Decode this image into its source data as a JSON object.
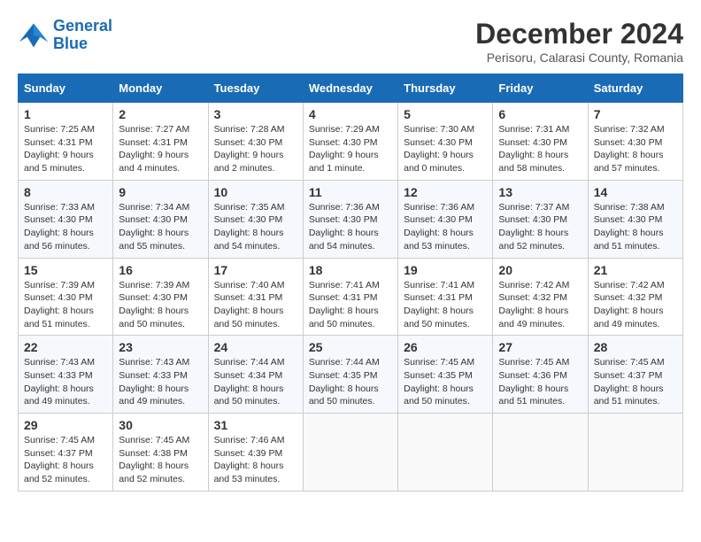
{
  "logo": {
    "line1": "General",
    "line2": "Blue"
  },
  "title": "December 2024",
  "subtitle": "Perisoru, Calarasi County, Romania",
  "days_of_week": [
    "Sunday",
    "Monday",
    "Tuesday",
    "Wednesday",
    "Thursday",
    "Friday",
    "Saturday"
  ],
  "weeks": [
    [
      {
        "day": "1",
        "info": "Sunrise: 7:25 AM\nSunset: 4:31 PM\nDaylight: 9 hours and 5 minutes."
      },
      {
        "day": "2",
        "info": "Sunrise: 7:27 AM\nSunset: 4:31 PM\nDaylight: 9 hours and 4 minutes."
      },
      {
        "day": "3",
        "info": "Sunrise: 7:28 AM\nSunset: 4:30 PM\nDaylight: 9 hours and 2 minutes."
      },
      {
        "day": "4",
        "info": "Sunrise: 7:29 AM\nSunset: 4:30 PM\nDaylight: 9 hours and 1 minute."
      },
      {
        "day": "5",
        "info": "Sunrise: 7:30 AM\nSunset: 4:30 PM\nDaylight: 9 hours and 0 minutes."
      },
      {
        "day": "6",
        "info": "Sunrise: 7:31 AM\nSunset: 4:30 PM\nDaylight: 8 hours and 58 minutes."
      },
      {
        "day": "7",
        "info": "Sunrise: 7:32 AM\nSunset: 4:30 PM\nDaylight: 8 hours and 57 minutes."
      }
    ],
    [
      {
        "day": "8",
        "info": "Sunrise: 7:33 AM\nSunset: 4:30 PM\nDaylight: 8 hours and 56 minutes."
      },
      {
        "day": "9",
        "info": "Sunrise: 7:34 AM\nSunset: 4:30 PM\nDaylight: 8 hours and 55 minutes."
      },
      {
        "day": "10",
        "info": "Sunrise: 7:35 AM\nSunset: 4:30 PM\nDaylight: 8 hours and 54 minutes."
      },
      {
        "day": "11",
        "info": "Sunrise: 7:36 AM\nSunset: 4:30 PM\nDaylight: 8 hours and 54 minutes."
      },
      {
        "day": "12",
        "info": "Sunrise: 7:36 AM\nSunset: 4:30 PM\nDaylight: 8 hours and 53 minutes."
      },
      {
        "day": "13",
        "info": "Sunrise: 7:37 AM\nSunset: 4:30 PM\nDaylight: 8 hours and 52 minutes."
      },
      {
        "day": "14",
        "info": "Sunrise: 7:38 AM\nSunset: 4:30 PM\nDaylight: 8 hours and 51 minutes."
      }
    ],
    [
      {
        "day": "15",
        "info": "Sunrise: 7:39 AM\nSunset: 4:30 PM\nDaylight: 8 hours and 51 minutes."
      },
      {
        "day": "16",
        "info": "Sunrise: 7:39 AM\nSunset: 4:30 PM\nDaylight: 8 hours and 50 minutes."
      },
      {
        "day": "17",
        "info": "Sunrise: 7:40 AM\nSunset: 4:31 PM\nDaylight: 8 hours and 50 minutes."
      },
      {
        "day": "18",
        "info": "Sunrise: 7:41 AM\nSunset: 4:31 PM\nDaylight: 8 hours and 50 minutes."
      },
      {
        "day": "19",
        "info": "Sunrise: 7:41 AM\nSunset: 4:31 PM\nDaylight: 8 hours and 50 minutes."
      },
      {
        "day": "20",
        "info": "Sunrise: 7:42 AM\nSunset: 4:32 PM\nDaylight: 8 hours and 49 minutes."
      },
      {
        "day": "21",
        "info": "Sunrise: 7:42 AM\nSunset: 4:32 PM\nDaylight: 8 hours and 49 minutes."
      }
    ],
    [
      {
        "day": "22",
        "info": "Sunrise: 7:43 AM\nSunset: 4:33 PM\nDaylight: 8 hours and 49 minutes."
      },
      {
        "day": "23",
        "info": "Sunrise: 7:43 AM\nSunset: 4:33 PM\nDaylight: 8 hours and 49 minutes."
      },
      {
        "day": "24",
        "info": "Sunrise: 7:44 AM\nSunset: 4:34 PM\nDaylight: 8 hours and 50 minutes."
      },
      {
        "day": "25",
        "info": "Sunrise: 7:44 AM\nSunset: 4:35 PM\nDaylight: 8 hours and 50 minutes."
      },
      {
        "day": "26",
        "info": "Sunrise: 7:45 AM\nSunset: 4:35 PM\nDaylight: 8 hours and 50 minutes."
      },
      {
        "day": "27",
        "info": "Sunrise: 7:45 AM\nSunset: 4:36 PM\nDaylight: 8 hours and 51 minutes."
      },
      {
        "day": "28",
        "info": "Sunrise: 7:45 AM\nSunset: 4:37 PM\nDaylight: 8 hours and 51 minutes."
      }
    ],
    [
      {
        "day": "29",
        "info": "Sunrise: 7:45 AM\nSunset: 4:37 PM\nDaylight: 8 hours and 52 minutes."
      },
      {
        "day": "30",
        "info": "Sunrise: 7:45 AM\nSunset: 4:38 PM\nDaylight: 8 hours and 52 minutes."
      },
      {
        "day": "31",
        "info": "Sunrise: 7:46 AM\nSunset: 4:39 PM\nDaylight: 8 hours and 53 minutes."
      },
      {
        "day": "",
        "info": ""
      },
      {
        "day": "",
        "info": ""
      },
      {
        "day": "",
        "info": ""
      },
      {
        "day": "",
        "info": ""
      }
    ]
  ]
}
